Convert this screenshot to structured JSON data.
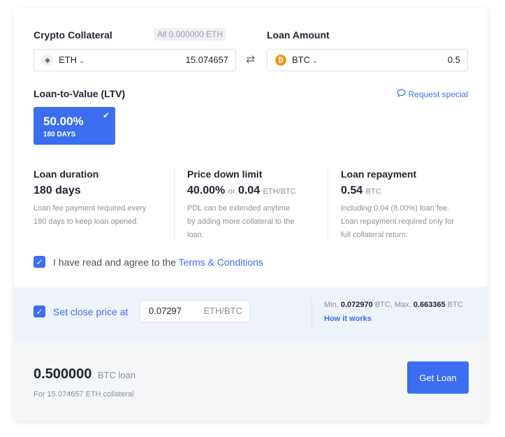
{
  "collateral": {
    "label": "Crypto Collateral",
    "all_badge": "All 0.000000 ETH",
    "currency": "ETH",
    "amount": "15.074657"
  },
  "loan": {
    "label": "Loan Amount",
    "currency": "BTC",
    "amount": "0.5"
  },
  "ltv": {
    "label": "Loan-to-Value (LTV)",
    "request_special": "Request special",
    "option": {
      "percent": "50.00%",
      "days": "180 DAYS",
      "selected": true
    }
  },
  "info": {
    "duration": {
      "title": "Loan duration",
      "value": "180 days",
      "desc_lines": [
        "Loan fee payment required every",
        "180 days to keep loan opened."
      ]
    },
    "pdl": {
      "title": "Price down limit",
      "value": "40.00%",
      "or": "or",
      "value2": "0.04",
      "unit": "ETH/BTC",
      "desc_lines": [
        "PDL can be extended anytime",
        "by adding more collateral to the",
        "loan."
      ]
    },
    "repayment": {
      "title": "Loan repayment",
      "value": "0.54",
      "unit": "BTC",
      "desc_lines": [
        "Including 0.04 (8.00%) loan fee.",
        "Loan repayment required only for",
        "full collateral return."
      ]
    }
  },
  "agreement": {
    "text": "I have read and agree to the ",
    "link": "Terms & Conditions",
    "checked": true
  },
  "close_price": {
    "label": "Set close price at",
    "value": "0.07297",
    "unit": "ETH/BTC",
    "min_label": "Min.",
    "min_value": "0.072970",
    "max_label": "BTC, Max.",
    "max_value": "0.663365",
    "max_unit": "BTC",
    "how_it_works": "How it works",
    "checked": true
  },
  "summary": {
    "amount": "0.500000",
    "unit": "BTC loan",
    "sub": "For 15.074657 ETH collateral",
    "button": "Get Loan"
  },
  "colors": {
    "accent": "#3b6ef0",
    "btc": "#f7931a"
  }
}
